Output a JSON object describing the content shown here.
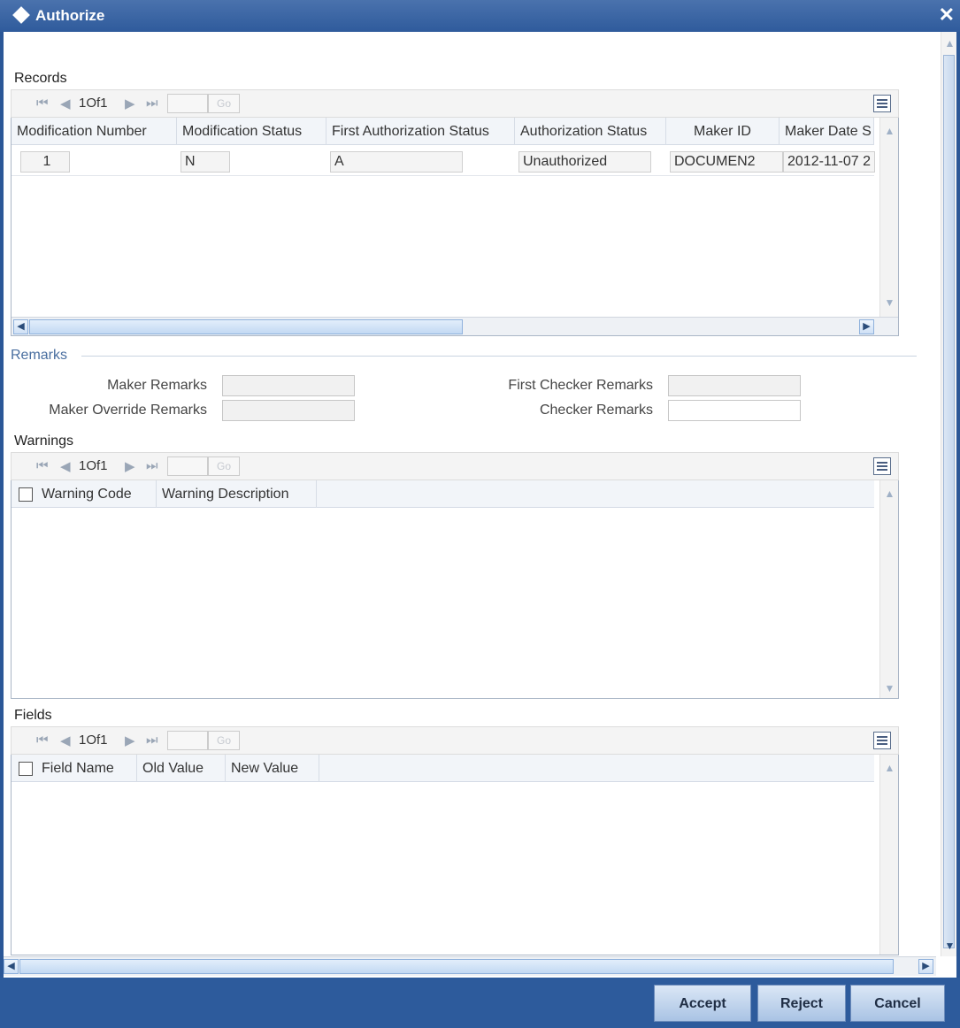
{
  "window": {
    "title": "Authorize",
    "close": "✕"
  },
  "nav_common": {
    "first": "⏮",
    "prev": "◀",
    "next": "▶",
    "last": "⏭",
    "go": "Go"
  },
  "records": {
    "label": "Records",
    "page": "1Of1",
    "columns": [
      "Modification Number",
      "Modification Status",
      "First Authorization Status",
      "Authorization Status",
      "Maker ID",
      "Maker Date S"
    ],
    "row": [
      "1",
      "N",
      "A",
      "Unauthorized",
      "DOCUMEN2",
      "2012-11-07 2"
    ]
  },
  "remarks": {
    "title": "Remarks",
    "maker_remarks": "Maker Remarks",
    "maker_override_remarks": "Maker Override Remarks",
    "first_checker_remarks": "First Checker Remarks",
    "checker_remarks": "Checker Remarks"
  },
  "warnings": {
    "label": "Warnings",
    "page": "1Of1",
    "columns": [
      "Warning Code",
      "Warning Description"
    ]
  },
  "fields": {
    "label": "Fields",
    "page": "1Of1",
    "columns": [
      "Field Name",
      "Old Value",
      "New Value"
    ]
  },
  "buttons": {
    "accept": "Accept",
    "reject": "Reject",
    "cancel": "Cancel"
  },
  "icons": [
    "diamond-icon",
    "close-icon",
    "first-page-icon",
    "prev-page-icon",
    "next-page-icon",
    "last-page-icon",
    "grid-settings-icon"
  ],
  "colors": {
    "titlebar": "#2f5b9c",
    "footer": "#2d5b9c",
    "button": "#bcd2ee"
  }
}
